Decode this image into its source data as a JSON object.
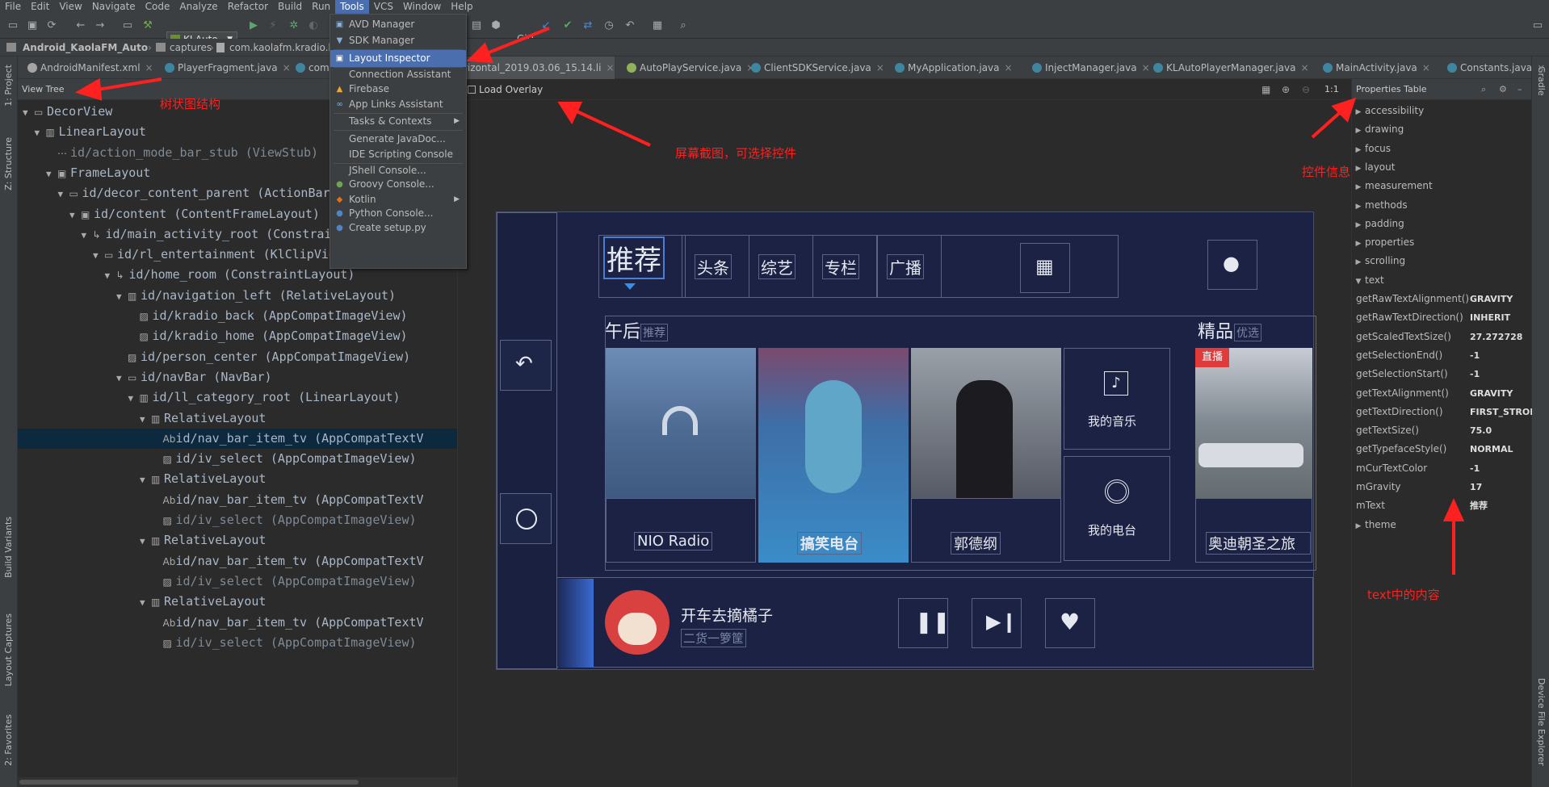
{
  "menubar": [
    "File",
    "Edit",
    "View",
    "Navigate",
    "Code",
    "Analyze",
    "Refactor",
    "Build",
    "Run",
    "Tools",
    "VCS",
    "Window",
    "Help"
  ],
  "toolbar": {
    "run_config": "KLAuto",
    "git_label": "Git:"
  },
  "breadcrumb": [
    "Android_KaolaFM_Auto",
    "captures",
    "com.kaolafm.kradio.l"
  ],
  "tabs": [
    "AndroidManifest.xml",
    "PlayerFragment.java",
    "com",
    "rizontal_2019.03.06_15.14.li",
    "AutoPlayService.java",
    "ClientSDKService.java",
    "MyApplication.java",
    "InjectManager.java",
    "KLAutoPlayerManager.java",
    "MainActivity.java",
    "Constants.java"
  ],
  "left_strip": [
    "1: Project",
    "Z: Structure",
    "Build Variants",
    "Layout Captures",
    "2: Favorites"
  ],
  "right_strip": [
    "Gradle",
    "Device File Explorer"
  ],
  "view_tree": {
    "header": "View Tree",
    "rows": [
      {
        "text": "DecorView",
        "indent": 0,
        "arrow": "▼",
        "icon": "▭",
        "dim": false
      },
      {
        "text": "LinearLayout",
        "indent": 1,
        "arrow": "▼",
        "icon": "▥",
        "dim": false
      },
      {
        "text": "id/action_mode_bar_stub (ViewStub)",
        "indent": 2,
        "arrow": "",
        "icon": "⋯",
        "dim": true
      },
      {
        "text": "FrameLayout",
        "indent": 2,
        "arrow": "▼",
        "icon": "▣",
        "dim": false
      },
      {
        "text": "id/decor_content_parent (ActionBarO",
        "indent": 3,
        "arrow": "▼",
        "icon": "▭",
        "dim": false
      },
      {
        "text": "id/content (ContentFrameLayout)",
        "indent": 4,
        "arrow": "▼",
        "icon": "▣",
        "dim": false
      },
      {
        "text": "id/main_activity_root (ConstraintLayout)",
        "indent": 5,
        "arrow": "▼",
        "icon": "↳",
        "dim": false
      },
      {
        "text": "id/rl_entertainment (KlClipView)",
        "indent": 6,
        "arrow": "▼",
        "icon": "▭",
        "dim": false
      },
      {
        "text": "id/home_room (ConstraintLayout)",
        "indent": 7,
        "arrow": "▼",
        "icon": "↳",
        "dim": false
      },
      {
        "text": "id/navigation_left (RelativeLayout)",
        "indent": 8,
        "arrow": "▼",
        "icon": "▥",
        "dim": false
      },
      {
        "text": "id/kradio_back (AppCompatImageView)",
        "indent": 9,
        "arrow": "",
        "icon": "▨",
        "dim": false
      },
      {
        "text": "id/kradio_home (AppCompatImageView)",
        "indent": 9,
        "arrow": "",
        "icon": "▨",
        "dim": false
      },
      {
        "text": "id/person_center (AppCompatImageView)",
        "indent": 8,
        "arrow": "",
        "icon": "▨",
        "dim": false
      },
      {
        "text": "id/navBar (NavBar)",
        "indent": 8,
        "arrow": "▼",
        "icon": "▭",
        "dim": false
      },
      {
        "text": "id/ll_category_root (LinearLayout)",
        "indent": 9,
        "arrow": "▼",
        "icon": "▥",
        "dim": false
      },
      {
        "text": "RelativeLayout",
        "indent": 10,
        "arrow": "▼",
        "icon": "▥",
        "dim": false
      },
      {
        "text": "id/nav_bar_item_tv (AppCompatTextV",
        "indent": 11,
        "arrow": "",
        "icon": "Ab",
        "dim": false,
        "selected": true
      },
      {
        "text": "id/iv_select (AppCompatImageView)",
        "indent": 11,
        "arrow": "",
        "icon": "▨",
        "dim": false
      },
      {
        "text": "RelativeLayout",
        "indent": 10,
        "arrow": "▼",
        "icon": "▥",
        "dim": false
      },
      {
        "text": "id/nav_bar_item_tv (AppCompatTextV",
        "indent": 11,
        "arrow": "",
        "icon": "Ab",
        "dim": false
      },
      {
        "text": "id/iv_select (AppCompatImageView)",
        "indent": 11,
        "arrow": "",
        "icon": "▨",
        "dim": true
      },
      {
        "text": "RelativeLayout",
        "indent": 10,
        "arrow": "▼",
        "icon": "▥",
        "dim": false
      },
      {
        "text": "id/nav_bar_item_tv (AppCompatTextV",
        "indent": 11,
        "arrow": "",
        "icon": "Ab",
        "dim": false
      },
      {
        "text": "id/iv_select (AppCompatImageView)",
        "indent": 11,
        "arrow": "",
        "icon": "▨",
        "dim": true
      },
      {
        "text": "RelativeLayout",
        "indent": 10,
        "arrow": "▼",
        "icon": "▥",
        "dim": false
      },
      {
        "text": "id/nav_bar_item_tv (AppCompatTextV",
        "indent": 11,
        "arrow": "",
        "icon": "Ab",
        "dim": false
      },
      {
        "text": "id/iv_select (AppCompatImageView)",
        "indent": 11,
        "arrow": "",
        "icon": "▨",
        "dim": true
      }
    ]
  },
  "center_toolbar": {
    "load_overlay": "Load Overlay",
    "ratio": "1:1"
  },
  "device": {
    "nav_items": [
      "推荐",
      "头条",
      "综艺",
      "专栏",
      "广播"
    ],
    "section1_title": "午后",
    "section1_tag": "推荐",
    "section2_title": "精品",
    "section2_tag": "优选",
    "cards": [
      "NIO Radio",
      "搞笑电台",
      "郭德纲"
    ],
    "small_cards": [
      "我的音乐",
      "我的电台"
    ],
    "live_badge": "直播",
    "card4_caption": "奥迪朝圣之旅",
    "player_title": "开车去摘橘子",
    "player_sub": "二货一箩筐"
  },
  "tools_menu": {
    "items": [
      {
        "label": "AVD Manager",
        "icon": "▣",
        "color": "#8bb0d8",
        "sub": false
      },
      {
        "label": "SDK Manager",
        "icon": "▼",
        "color": "#8bb0d8",
        "sub": false
      },
      {
        "label": "Layout Inspector",
        "icon": "▣",
        "color": "#ffffff",
        "sub": false,
        "highlight": true
      },
      {
        "label": "Connection Assistant",
        "icon": "",
        "color": "#bbb",
        "sub": false
      },
      {
        "label": "Firebase",
        "icon": "▲",
        "color": "#f5a623",
        "sub": false
      },
      {
        "label": "App Links Assistant",
        "icon": "∞",
        "color": "#7db3e8",
        "sub": false
      },
      {
        "label": "Tasks & Contexts",
        "icon": "",
        "color": "#bbb",
        "sub": true
      },
      {
        "label": "Generate JavaDoc...",
        "icon": "",
        "color": "#bbb",
        "sub": false
      },
      {
        "label": "IDE Scripting Console",
        "icon": "",
        "color": "#bbb",
        "sub": false
      },
      {
        "label": "JShell Console...",
        "icon": "",
        "color": "#bbb",
        "sub": false
      },
      {
        "label": "Groovy Console...",
        "icon": "●",
        "color": "#6aa84f",
        "sub": false
      },
      {
        "label": "Kotlin",
        "icon": "◆",
        "color": "#e0701e",
        "sub": true
      },
      {
        "label": "Python Console...",
        "icon": "●",
        "color": "#4a86c8",
        "sub": false
      },
      {
        "label": "Create setup.py",
        "icon": "●",
        "color": "#4a86c8",
        "sub": false
      }
    ]
  },
  "properties": {
    "header": "Properties Table",
    "rows": [
      {
        "key": "accessibility",
        "value": "",
        "group": true,
        "open": false
      },
      {
        "key": "drawing",
        "value": "",
        "group": true,
        "open": false
      },
      {
        "key": "focus",
        "value": "",
        "group": true,
        "open": false
      },
      {
        "key": "layout",
        "value": "",
        "group": true,
        "open": false
      },
      {
        "key": "measurement",
        "value": "",
        "group": true,
        "open": false
      },
      {
        "key": "methods",
        "value": "",
        "group": true,
        "open": false
      },
      {
        "key": "padding",
        "value": "",
        "group": true,
        "open": false
      },
      {
        "key": "properties",
        "value": "",
        "group": true,
        "open": false
      },
      {
        "key": "scrolling",
        "value": "",
        "group": true,
        "open": false
      },
      {
        "key": "text",
        "value": "",
        "group": true,
        "open": true
      },
      {
        "key": "getRawTextAlignment()",
        "value": "GRAVITY",
        "group": false
      },
      {
        "key": "getRawTextDirection()",
        "value": "INHERIT",
        "group": false
      },
      {
        "key": "getScaledTextSize()",
        "value": "27.272728",
        "group": false
      },
      {
        "key": "getSelectionEnd()",
        "value": "-1",
        "group": false
      },
      {
        "key": "getSelectionStart()",
        "value": "-1",
        "group": false
      },
      {
        "key": "getTextAlignment()",
        "value": "GRAVITY",
        "group": false
      },
      {
        "key": "getTextDirection()",
        "value": "FIRST_STRON",
        "group": false
      },
      {
        "key": "getTextSize()",
        "value": "75.0",
        "group": false
      },
      {
        "key": "getTypefaceStyle()",
        "value": "NORMAL",
        "group": false
      },
      {
        "key": "mCurTextColor",
        "value": "-1",
        "group": false
      },
      {
        "key": "mGravity",
        "value": "17",
        "group": false
      },
      {
        "key": "mText",
        "value": "推荐",
        "group": false
      },
      {
        "key": "theme",
        "value": "",
        "group": true,
        "open": false
      }
    ]
  },
  "annotations": {
    "tree": "树状图结构",
    "screen": "屏幕截图，可选择控件",
    "props": "控件信息",
    "text": "text中的内容"
  }
}
